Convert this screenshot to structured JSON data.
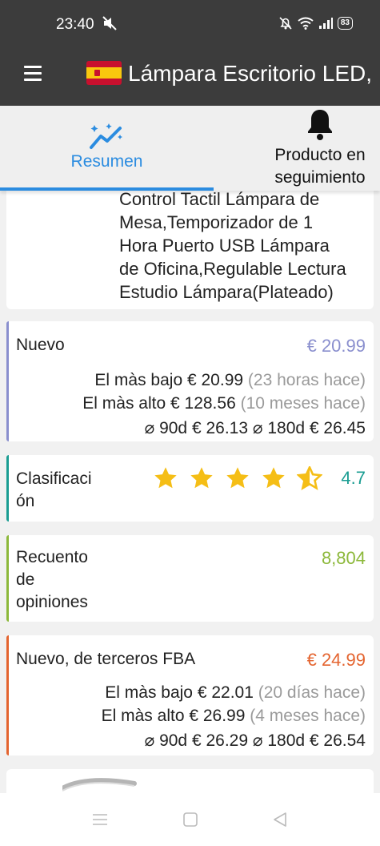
{
  "status_bar": {
    "time": "23:40",
    "battery": "83",
    "icons": [
      "mute-icon",
      "bell-off-icon",
      "wifi-icon",
      "signal-icon",
      "battery-icon"
    ]
  },
  "app_bar": {
    "title": "Lámpara Escritorio LED,",
    "flag": "spain-flag-icon"
  },
  "tabs": [
    {
      "label": "Resumen",
      "icon": "trend-chart-icon",
      "active": true
    },
    {
      "label": "Producto en seguimiento",
      "icon": "bell-icon",
      "active": false
    }
  ],
  "description": {
    "lines": [
      "Control Tactil Lámpara de",
      "Mesa,Temporizador de 1",
      "Hora Puerto USB Lámpara",
      "de Oficina,Regulable Lectura",
      "Estudio Lámpara(Plateado)"
    ]
  },
  "new_price": {
    "label": "Nuevo",
    "price": "€ 20.99",
    "lowest_label": "El màs bajo",
    "lowest_value": "€ 20.99",
    "lowest_when": "(23 horas hace)",
    "highest_label": "El màs alto",
    "highest_value": "€ 128.56",
    "highest_when": "(10 meses hace)",
    "avg90_label": "⌀ 90d",
    "avg90_value": "€ 26.13",
    "avg180_label": "⌀ 180d",
    "avg180_value": "€ 26.45",
    "accent": "#8a8fce"
  },
  "rating": {
    "label_line1": "Clasificaci",
    "label_line2": "ón",
    "value": "4.7",
    "stars": 4.5,
    "star_color": "#f5be16",
    "accent": "#1a9d92"
  },
  "reviews": {
    "label_lines": [
      "Recuento",
      "de",
      "opiniones"
    ],
    "value": "8,804",
    "accent": "#8cb83a"
  },
  "fba": {
    "label": "Nuevo, de terceros FBA",
    "price": "€ 24.99",
    "lowest_label": "El màs bajo",
    "lowest_value": "€ 22.01",
    "lowest_when": "(20 días hace)",
    "highest_label": "El màs alto",
    "highest_value": "€ 26.99",
    "highest_when": "(4 meses hace)",
    "avg90_label": "⌀ 90d",
    "avg90_value": "€ 26.29",
    "avg180_label": "⌀ 180d",
    "avg180_value": "€ 26.54",
    "accent": "#e4642f"
  },
  "nav_bar": {
    "buttons": [
      "menu-icon",
      "home-icon",
      "back-icon"
    ]
  }
}
